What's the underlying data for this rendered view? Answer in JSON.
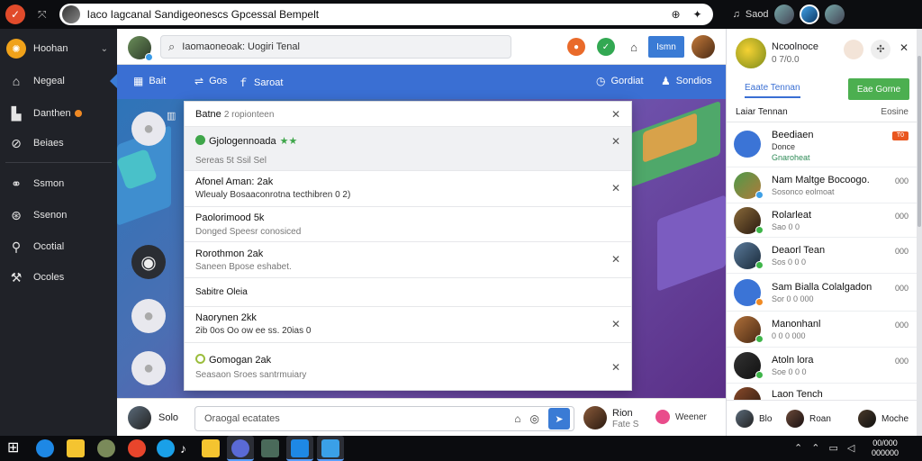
{
  "titlebar": {
    "title": "Iaco Iagcanal Sandigeonescs Gpcessal Bempelt",
    "user_label": "Saod"
  },
  "sidebar": {
    "items": [
      {
        "label": "Hoohan",
        "icon": "brand-icon"
      },
      {
        "label": "Negeal",
        "icon": "home-icon"
      },
      {
        "label": "Danthen",
        "icon": "store-icon"
      },
      {
        "label": "Beiaes",
        "icon": "search-icon"
      },
      {
        "label": "Ssmon",
        "icon": "link-icon"
      },
      {
        "label": "Ssenon",
        "icon": "globe-icon"
      },
      {
        "label": "Ocotial",
        "icon": "person-icon"
      },
      {
        "label": "Ocoles",
        "icon": "tools-icon"
      }
    ]
  },
  "topbar": {
    "search_text": "Iaomaoneoak: Uogiri Tenal",
    "button_label": "Ismn"
  },
  "bluebar": {
    "left": [
      "Bait",
      "Gos",
      "Saroat"
    ],
    "right": [
      "Gordiat",
      "Sondios"
    ]
  },
  "dropdown": {
    "rows": [
      {
        "title": "Batne",
        "sub": "2 ropionteen"
      },
      {
        "title": "Gjologennoada",
        "sub": "Sereas 5t Ssil  Sel"
      },
      {
        "title": "Afonel Aman: 2ak",
        "sub": "Wleualy Bosaaconrotna tecthibren 0 2)"
      },
      {
        "title": "Paolorimood 5k",
        "sub": "Donged Speesr conosiced"
      },
      {
        "title": "Rorothmon 2ak",
        "sub": "Saneen Bpose eshabet."
      },
      {
        "title": "Sabitre Oleia",
        "sub": ""
      },
      {
        "title": "Naorynen 2kk",
        "sub": "2ib 0os Oo ow ee ss. 20ias 0"
      },
      {
        "title": "Gomogan 2ak",
        "sub": "Seasaon Sroes santrmuiary"
      }
    ]
  },
  "chatbar": {
    "sender": "Solo",
    "placeholder": "Oraogal ecatates",
    "friend_name": "Rion",
    "friend_sub": "Fate S",
    "status": "Weener"
  },
  "rightpanel": {
    "header_name": "Ncoolnoce",
    "header_sub": "0 7/0.0",
    "tab_label": "Eaate Tennan",
    "add_button": "Eae Gorne",
    "list_header_left": "Laiar Tennan",
    "list_header_right": "Eosine",
    "friends": [
      {
        "name": "Beediaen",
        "sub": "Donce",
        "sub2": "Gnaroheat",
        "right": "T0"
      },
      {
        "name": "Nam Maltge Bocoogo.",
        "sub": "Sosonco eolmoat",
        "right": "000"
      },
      {
        "name": "Rolarleat",
        "sub": "Sao  0  0",
        "right": "000"
      },
      {
        "name": "Deaorl Tean",
        "sub": "Sos  0 0 0",
        "right": "000"
      },
      {
        "name": "Sam Bialla Colalgadon",
        "sub": "Sor  0 0 000",
        "right": "000"
      },
      {
        "name": "Manonhanl",
        "sub": "0 0 0  000",
        "right": "000"
      },
      {
        "name": "Atoln lora",
        "sub": "Soe  0 0 0",
        "right": "000"
      },
      {
        "name": "Laon Tench",
        "sub": "",
        "right": ""
      }
    ],
    "footer": [
      "Blo",
      "Roan",
      "Moche"
    ]
  },
  "taskbar": {
    "clock_line1": "00/000",
    "clock_line2": "000000"
  }
}
